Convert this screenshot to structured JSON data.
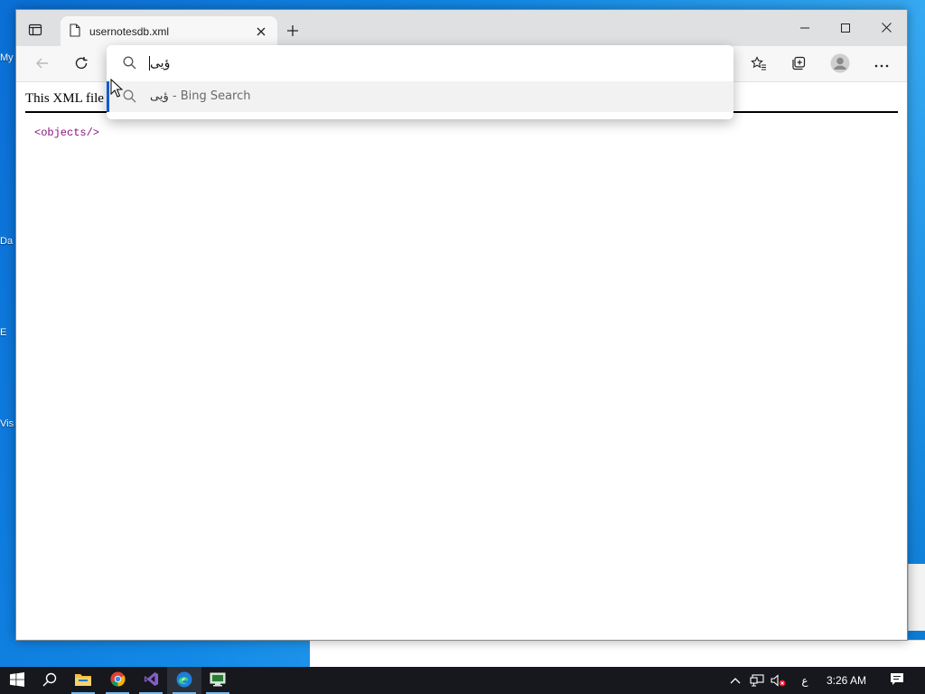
{
  "desktop": {
    "fragments": [
      "My",
      "Da",
      "E",
      "Vis"
    ]
  },
  "browser": {
    "tab": {
      "title": "usernotesdb.xml"
    },
    "toolbar": {
      "back_icon": "back-arrow-icon",
      "refresh_icon": "refresh-icon",
      "favorites_icon": "favorites-icon",
      "collections_icon": "collections-icon",
      "profile_icon": "profile-icon",
      "more_icon": "more-icon"
    },
    "omnibox": {
      "query": "ؤيى",
      "suggestion": {
        "query": "ؤيى",
        "hint": " - Bing Search"
      }
    },
    "page": {
      "notice": "This XML file",
      "xml_content": "<objects/>"
    }
  },
  "taskbar": {
    "apps": [
      "start",
      "search",
      "file-explorer",
      "chrome",
      "visual-studio",
      "edge",
      "remote-desktop"
    ],
    "tray": {
      "language": "ع",
      "time": "3:26 AM"
    }
  },
  "colors": {
    "accent": "#0f5bd3",
    "taskbar": "#16181d",
    "xml_tag": "#881280"
  }
}
